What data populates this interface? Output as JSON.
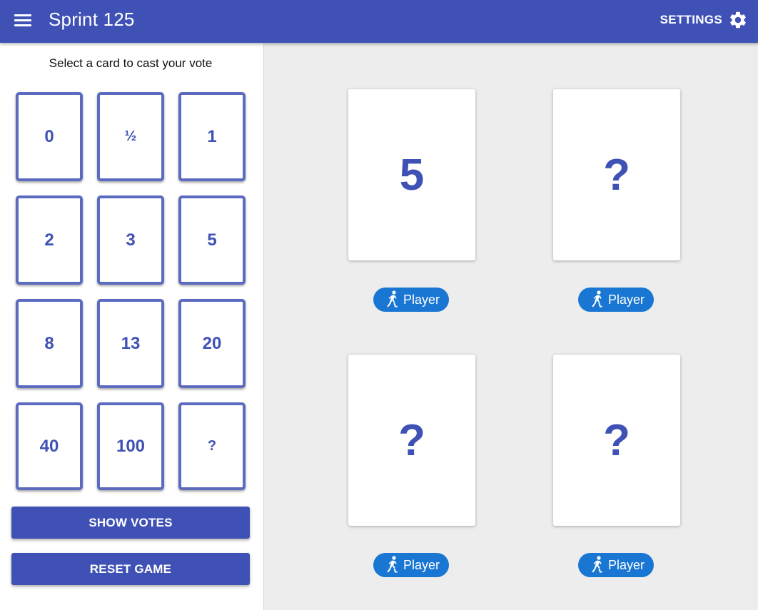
{
  "header": {
    "menu_icon": "menu-icon",
    "title": "Sprint 125",
    "settings_label": "SETTINGS",
    "settings_icon": "gear-icon",
    "color": "#3f51b5"
  },
  "sidebar": {
    "prompt": "Select a card to cast your vote",
    "cards": [
      "0",
      "½",
      "1",
      "2",
      "3",
      "5",
      "8",
      "13",
      "20",
      "40",
      "100",
      "?"
    ],
    "show_votes_label": "SHOW VOTES",
    "reset_game_label": "RESET GAME"
  },
  "table": {
    "players": [
      {
        "card": "5",
        "name": "Player",
        "icon": "skating-person-icon"
      },
      {
        "card": "?",
        "name": "Player",
        "icon": "skating-person-icon"
      },
      {
        "card": "?",
        "name": "Player",
        "icon": "skating-person-icon"
      },
      {
        "card": "?",
        "name": "Player",
        "icon": "skating-person-icon"
      }
    ],
    "chip_color": "#1976d2",
    "card_text_color": "#3f51b5"
  }
}
